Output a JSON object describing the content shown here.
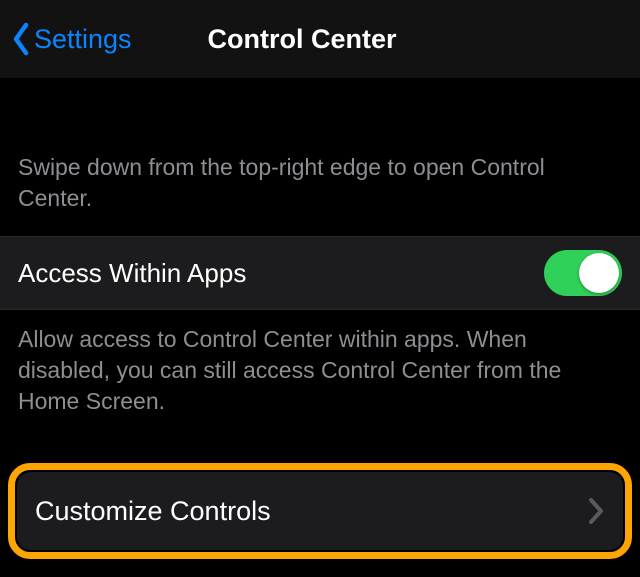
{
  "header": {
    "back_label": "Settings",
    "title": "Control Center"
  },
  "top_hint": "Swipe down from the top-right edge to open Control Center.",
  "access_row": {
    "label": "Access Within Apps",
    "switch_on": true
  },
  "access_hint": "Allow access to Control Center within apps. When disabled, you can still access Control Center from the Home Screen.",
  "customize_row": {
    "label": "Customize Controls"
  },
  "colors": {
    "accent_blue": "#0a84ff",
    "switch_green": "#30d158",
    "highlight_orange": "#ffa500"
  }
}
